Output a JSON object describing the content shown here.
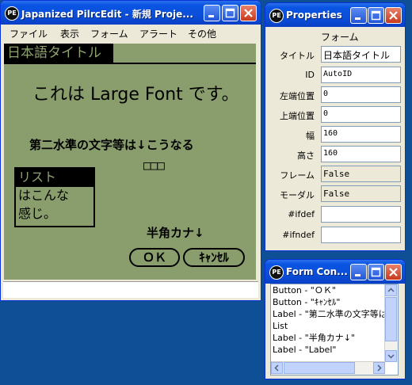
{
  "main_window": {
    "title": "Japanized PilrcEdit - 新規 Proje...",
    "app_icon": "PE",
    "menu": [
      "ファイル",
      "表示",
      "フォーム",
      "アラート",
      "その他"
    ],
    "form": {
      "title": "日本語タイトル",
      "large_label": "これは Large Font です。",
      "label2": "第二水準の文字等は↓こうなる",
      "boxes": "□□□",
      "list_items": [
        "リスト",
        "はこんな",
        "感じ。"
      ],
      "hankaku_label": "半角カナ↓",
      "ok_button": "ＯＫ",
      "cancel_button": "ｷｬﾝｾﾙ"
    }
  },
  "properties_window": {
    "title": "Properties",
    "app_icon": "PE",
    "header": "フォーム",
    "fields": [
      {
        "label": "タイトル",
        "value": "日本語タイトル",
        "readonly": false
      },
      {
        "label": "ID",
        "value": "AutoID",
        "readonly": false
      },
      {
        "label": "左端位置",
        "value": "0",
        "readonly": false
      },
      {
        "label": "上端位置",
        "value": "0",
        "readonly": false
      },
      {
        "label": "幅",
        "value": "160",
        "readonly": false
      },
      {
        "label": "高さ",
        "value": "160",
        "readonly": false
      },
      {
        "label": "フレーム",
        "value": "False",
        "readonly": true
      },
      {
        "label": "モーダル",
        "value": "False",
        "readonly": true
      },
      {
        "label": "#ifdef",
        "value": "",
        "readonly": false
      },
      {
        "label": "#ifndef",
        "value": "",
        "readonly": false
      }
    ]
  },
  "form_contents_window": {
    "title": "Form Con...",
    "app_icon": "PE",
    "items": [
      "Button - \"ＯＫ\"",
      "Button - \"ｷｬﾝｾﾙ\"",
      "Label - \"第二水準の文字等は",
      "List",
      "Label - \"半角カナ↓\"",
      "Label - \"Label\""
    ]
  },
  "colors": {
    "desktop": "#0f4f96",
    "titlebar": "#0a54e3",
    "lcd": "#899e6c",
    "window_face": "#ece9d8"
  }
}
